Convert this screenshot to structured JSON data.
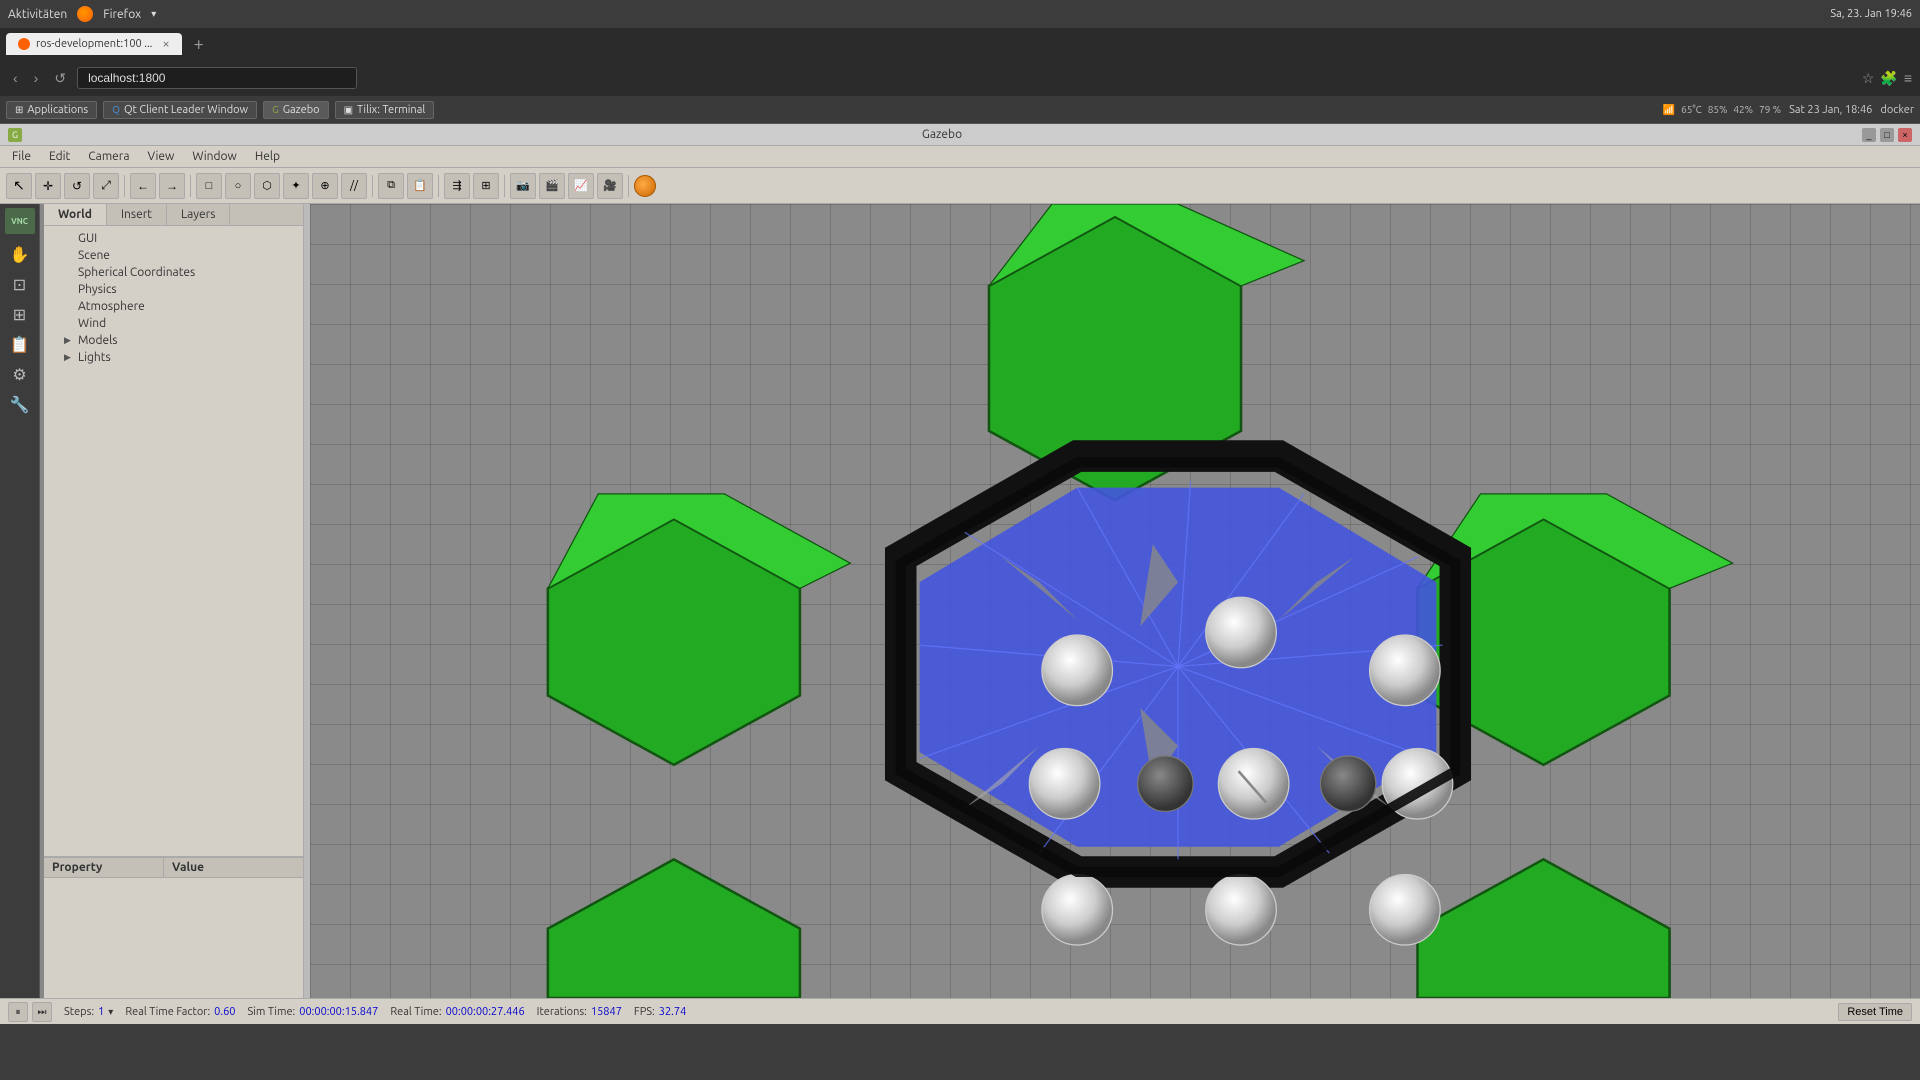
{
  "browser": {
    "activity": "Aktivitäten",
    "firefox_label": "Firefox",
    "tab_title": "ros-development:100 ...",
    "tab_close": "×",
    "address": "localhost:1800",
    "datetime": "Sa, 23. Jan  19:46",
    "temp": "65°C",
    "battery1": "85%",
    "battery2": "42%",
    "volume": "79 %"
  },
  "taskbar": {
    "items": [
      {
        "id": "applications",
        "label": "Applications"
      },
      {
        "id": "qt-client",
        "label": "Qt Client Leader Window"
      },
      {
        "id": "gazebo",
        "label": "Gazebo"
      },
      {
        "id": "tilix",
        "label": "Tilix: Terminal"
      }
    ],
    "tray": {
      "time": "Sat 23 Jan, 18:46",
      "docker": "docker"
    }
  },
  "gazebo": {
    "title": "Gazebo",
    "menu": [
      "File",
      "Edit",
      "Camera",
      "View",
      "Window",
      "Help"
    ],
    "tabs": {
      "world": "World",
      "insert": "Insert",
      "layers": "Layers"
    },
    "tree": {
      "items": [
        {
          "label": "GUI",
          "indent": 1,
          "has_children": false
        },
        {
          "label": "Scene",
          "indent": 1,
          "has_children": false
        },
        {
          "label": "Spherical Coordinates",
          "indent": 1,
          "has_children": false
        },
        {
          "label": "Physics",
          "indent": 1,
          "has_children": false
        },
        {
          "label": "Atmosphere",
          "indent": 1,
          "has_children": false
        },
        {
          "label": "Wind",
          "indent": 1,
          "has_children": false
        },
        {
          "label": "Models",
          "indent": 1,
          "has_children": true,
          "expanded": false
        },
        {
          "label": "Lights",
          "indent": 1,
          "has_children": true,
          "expanded": false
        }
      ]
    },
    "properties": {
      "col_property": "Property",
      "col_value": "Value"
    },
    "status": {
      "play_icon": "⏸",
      "step_icon": "⏭",
      "steps_label": "Steps:",
      "steps_value": "1",
      "rtf_label": "Real Time Factor:",
      "rtf_value": "0.60",
      "sim_time_label": "Sim Time:",
      "sim_time_value": "00:00:00:15.847",
      "real_time_label": "Real Time:",
      "real_time_value": "00:00:00:27.446",
      "iterations_label": "Iterations:",
      "iterations_value": "15847",
      "fps_label": "FPS:",
      "fps_value": "32.74",
      "reset_label": "Reset Time"
    }
  },
  "toolbar_icons": [
    "☩",
    "↖",
    "↺",
    "↗",
    "←",
    "→",
    "□",
    "○",
    "□",
    "✦",
    "⊕",
    "//",
    "▶",
    "||",
    "⚑",
    "🎥",
    "💾",
    "📈",
    "🎬"
  ]
}
